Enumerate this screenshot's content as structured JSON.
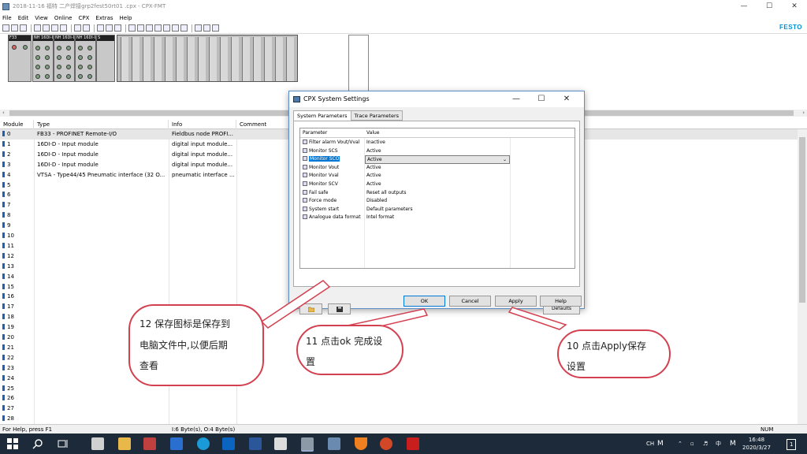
{
  "window": {
    "title": "2018-11-16 福特 二产焊接grp2fest50rt01 .cpx - CPX-FMT",
    "minimize": "—",
    "maximize": "☐",
    "close": "✕"
  },
  "menu": [
    "File",
    "Edit",
    "View",
    "Online",
    "CPX",
    "Extras",
    "Help"
  ],
  "brand": "FESTO",
  "hardware": {
    "module_labels": [
      "F33",
      "NH 16DI-D",
      "NH 16DI-D",
      "NH 16DI-D",
      "S"
    ]
  },
  "table": {
    "headers": [
      "Module",
      "Type",
      "Info",
      "Comment"
    ],
    "rows": [
      {
        "module": "0",
        "type": "FB33 - PROFINET Remote-I/O",
        "info": "Fieldbus node PROFI..."
      },
      {
        "module": "1",
        "type": "16DI-D - Input module",
        "info": "digital input module..."
      },
      {
        "module": "2",
        "type": "16DI-D - Input module",
        "info": "digital input module..."
      },
      {
        "module": "3",
        "type": "16DI-D - Input module",
        "info": "digital input module..."
      },
      {
        "module": "4",
        "type": "VTSA - Type44/45 Pneumatic interface (32 O...",
        "info": "pneumatic interface ..."
      },
      {
        "module": "5",
        "type": "",
        "info": ""
      },
      {
        "module": "6",
        "type": "",
        "info": ""
      },
      {
        "module": "7",
        "type": "",
        "info": ""
      },
      {
        "module": "8",
        "type": "",
        "info": ""
      },
      {
        "module": "9",
        "type": "",
        "info": ""
      },
      {
        "module": "10",
        "type": "",
        "info": ""
      },
      {
        "module": "11",
        "type": "",
        "info": ""
      },
      {
        "module": "12",
        "type": "",
        "info": ""
      },
      {
        "module": "13",
        "type": "",
        "info": ""
      },
      {
        "module": "14",
        "type": "",
        "info": ""
      },
      {
        "module": "15",
        "type": "",
        "info": ""
      },
      {
        "module": "16",
        "type": "",
        "info": ""
      },
      {
        "module": "17",
        "type": "",
        "info": ""
      },
      {
        "module": "18",
        "type": "",
        "info": ""
      },
      {
        "module": "19",
        "type": "",
        "info": ""
      },
      {
        "module": "20",
        "type": "",
        "info": ""
      },
      {
        "module": "21",
        "type": "",
        "info": ""
      },
      {
        "module": "22",
        "type": "",
        "info": ""
      },
      {
        "module": "23",
        "type": "",
        "info": ""
      },
      {
        "module": "24",
        "type": "",
        "info": ""
      },
      {
        "module": "25",
        "type": "",
        "info": ""
      },
      {
        "module": "26",
        "type": "",
        "info": ""
      },
      {
        "module": "27",
        "type": "",
        "info": ""
      },
      {
        "module": "28",
        "type": "",
        "info": ""
      }
    ]
  },
  "status": {
    "help": "For Help, press F1",
    "io": "I:6 Byte(s), O:4 Byte(s)",
    "num": "NUM"
  },
  "dialog": {
    "title": "CPX System Settings",
    "tabs": [
      "System Parameters",
      "Trace Parameters"
    ],
    "grid_headers": [
      "Parameter",
      "Value"
    ],
    "params": [
      {
        "name": "Filter alarm Vout/Vval",
        "value": "Inactive"
      },
      {
        "name": "Monitor SCS",
        "value": "Active"
      },
      {
        "name": "Monitor SCO",
        "value": "Active"
      },
      {
        "name": "Monitor Vout",
        "value": "Active"
      },
      {
        "name": "Monitor Vval",
        "value": "Active"
      },
      {
        "name": "Monitor SCV",
        "value": "Active"
      },
      {
        "name": "Fail safe",
        "value": "Reset all outputs"
      },
      {
        "name": "Force mode",
        "value": "Disabled"
      },
      {
        "name": "System start",
        "value": "Default parameters"
      },
      {
        "name": "Analogue data format",
        "value": "Intel format"
      }
    ],
    "defaults": "Defaults",
    "buttons": {
      "ok": "OK",
      "cancel": "Cancel",
      "apply": "Apply",
      "help": "Help"
    }
  },
  "annotations": {
    "save": [
      "12 保存图标是保存到",
      "电脑文件中,以便后期",
      "查看"
    ],
    "ok": [
      "11 点击ok 完成设",
      "置"
    ],
    "apply": [
      "10 点击Apply保存",
      "设置"
    ]
  },
  "taskbar": {
    "lang": "CH",
    "ime": "中",
    "time": "16:48",
    "date": "2020/3/27",
    "notif": "1"
  },
  "colors": {
    "accent": "#0078d7",
    "brand": "#0090d0",
    "callout": "#d34050",
    "taskbar": "#1c2a3a"
  }
}
